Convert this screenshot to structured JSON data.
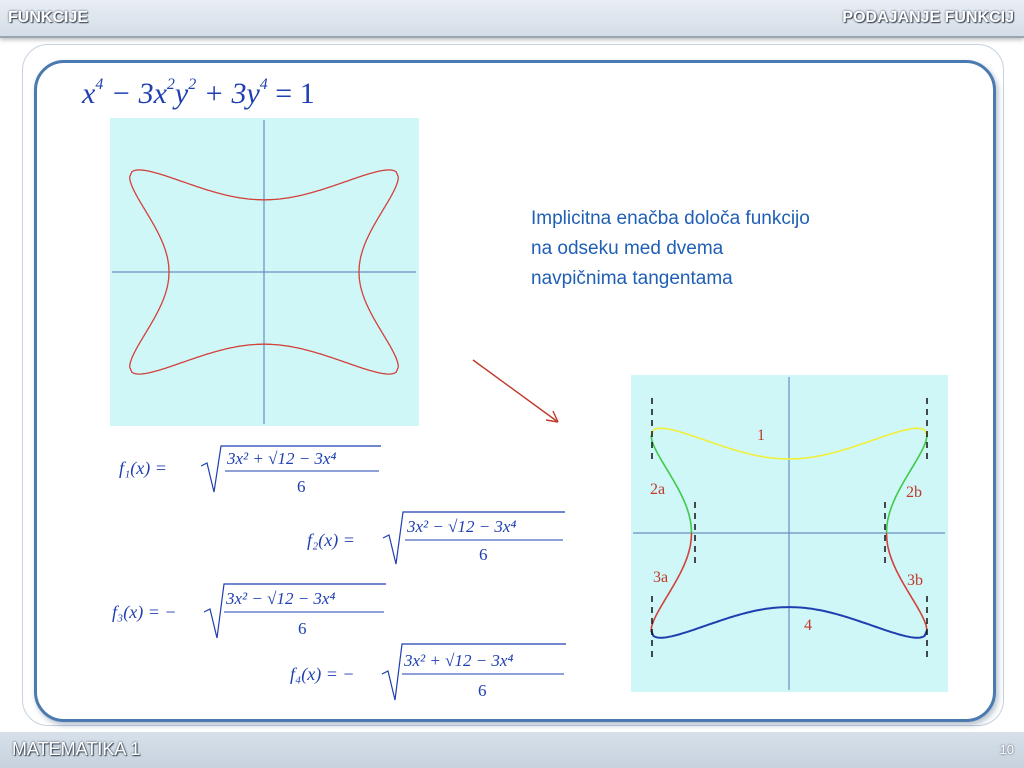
{
  "header": {
    "left_title": "FUNKCIJE",
    "right_title": "PODAJANJE FUNKCIJ"
  },
  "footer": {
    "course": "MATEMATIKA 1",
    "page_number": "10"
  },
  "equation": {
    "term1": "x",
    "exp1": "4",
    "term2": " − 3x",
    "exp2": "2",
    "term3": "y",
    "exp3": "2",
    "term4": " + 3y",
    "exp4": "4",
    "term5": " = 1"
  },
  "description": {
    "line1": "Implicitna enačba določa funkcijo",
    "line2": "na odseku med dvema",
    "line3": "navpičnima tangentama"
  },
  "formulas": {
    "f1": {
      "lhs": "f₁(x) =",
      "numerator": "3x² + √12 − 3x⁴",
      "denominator": "6"
    },
    "f2": {
      "lhs": "f₂(x) =",
      "numerator": "3x² − √12 − 3x⁴",
      "denominator": "6"
    },
    "f3": {
      "lhs": "f₃(x) = −",
      "numerator": "3x² − √12 − 3x⁴",
      "denominator": "6"
    },
    "f4": {
      "lhs": "f₄(x) = −",
      "numerator": "3x² + √12 − 3x⁴",
      "denominator": "6"
    }
  },
  "segment_labels": {
    "s1": "1",
    "s2a": "2a",
    "s2b": "2b",
    "s3a": "3a",
    "s3b": "3b",
    "s4": "4"
  },
  "colors": {
    "plot_background": "#cff7f7",
    "axis": "#6b8fc2",
    "curve_full": "#d2413a",
    "segment_1": "#f0ef3c",
    "segment_2": "#3fc94a",
    "segment_3": "#d2413a",
    "segment_4": "#1f3fb0",
    "arrow": "#c0392b"
  }
}
